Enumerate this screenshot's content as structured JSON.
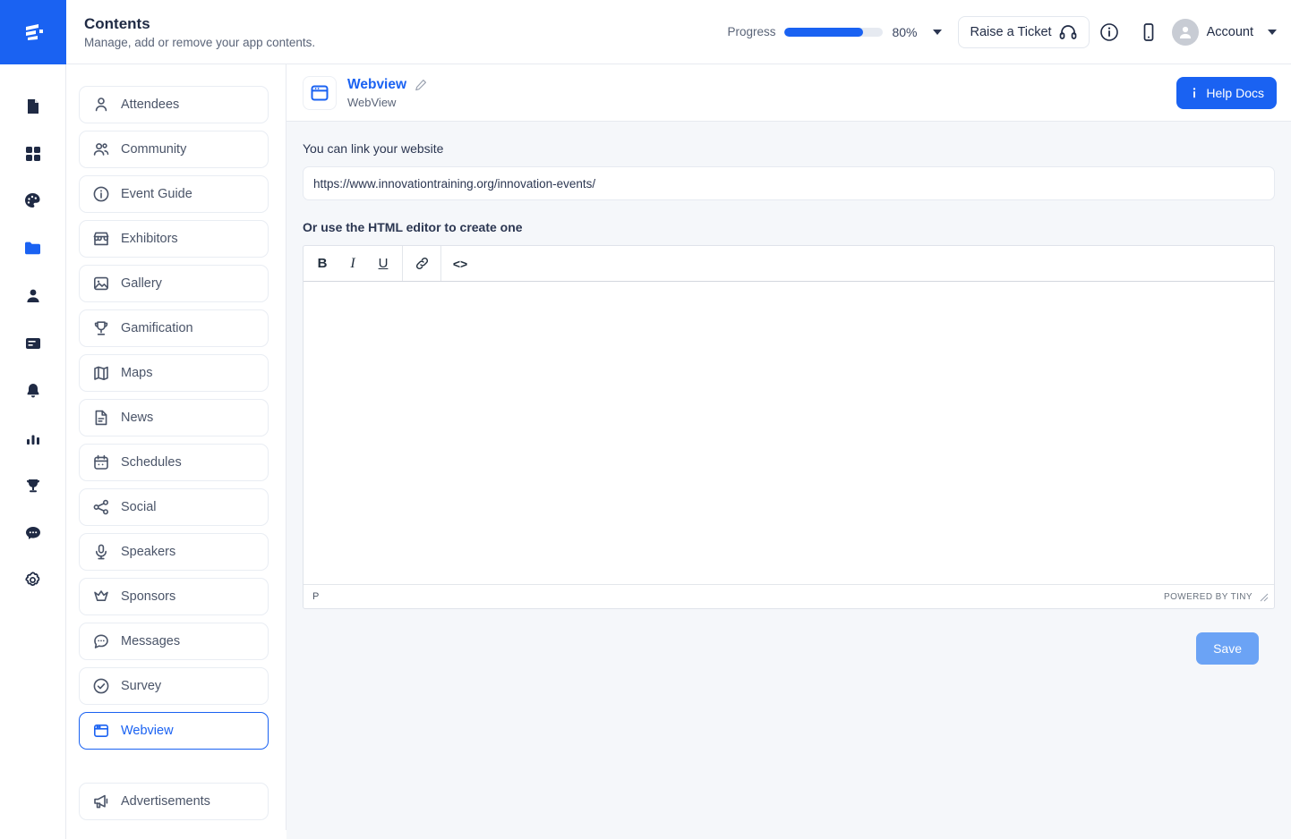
{
  "header": {
    "title": "Contents",
    "subtitle": "Manage, add or remove your app contents.",
    "progress_label": "Progress",
    "progress_percent": "80%",
    "progress_value": 80,
    "ticket_button": "Raise a Ticket",
    "account_label": "Account",
    "logo_icon": "app-logo-icon",
    "info_icon": "info-circle-icon",
    "mobile_icon": "mobile-device-icon",
    "headset_icon": "headset-icon",
    "accent_color": "#1a62f2"
  },
  "rail": {
    "items": [
      {
        "name": "documents",
        "icon": "document-icon",
        "active": false
      },
      {
        "name": "dashboard",
        "icon": "grid-icon",
        "active": false
      },
      {
        "name": "design",
        "icon": "palette-icon",
        "active": false
      },
      {
        "name": "contents",
        "icon": "folder-icon",
        "active": true
      },
      {
        "name": "people",
        "icon": "person-icon",
        "active": false
      },
      {
        "name": "cards",
        "icon": "card-icon",
        "active": false
      },
      {
        "name": "notifications",
        "icon": "bell-icon",
        "active": false
      },
      {
        "name": "analytics",
        "icon": "bar-chart-icon",
        "active": false
      },
      {
        "name": "gamification",
        "icon": "trophy-icon",
        "active": false
      },
      {
        "name": "messages",
        "icon": "chat-icon",
        "active": false
      },
      {
        "name": "settings",
        "icon": "gear-icon",
        "active": false
      }
    ]
  },
  "menu": {
    "items": [
      {
        "label": "Attendees",
        "icon": "person-icon",
        "active": false
      },
      {
        "label": "Community",
        "icon": "people-icon",
        "active": false
      },
      {
        "label": "Event Guide",
        "icon": "info-circle-icon",
        "active": false
      },
      {
        "label": "Exhibitors",
        "icon": "store-icon",
        "active": false
      },
      {
        "label": "Gallery",
        "icon": "image-icon",
        "active": false
      },
      {
        "label": "Gamification",
        "icon": "trophy-icon",
        "active": false
      },
      {
        "label": "Maps",
        "icon": "map-icon",
        "active": false
      },
      {
        "label": "News",
        "icon": "news-icon",
        "active": false
      },
      {
        "label": "Schedules",
        "icon": "calendar-icon",
        "active": false
      },
      {
        "label": "Social",
        "icon": "share-icon",
        "active": false
      },
      {
        "label": "Speakers",
        "icon": "microphone-icon",
        "active": false
      },
      {
        "label": "Sponsors",
        "icon": "crown-icon",
        "active": false
      },
      {
        "label": "Messages",
        "icon": "chat-icon",
        "active": false
      },
      {
        "label": "Survey",
        "icon": "check-circle-icon",
        "active": false
      },
      {
        "label": "Webview",
        "icon": "webview-icon",
        "active": true
      }
    ],
    "footer_items": [
      {
        "label": "Advertisements",
        "icon": "megaphone-icon",
        "active": false
      }
    ]
  },
  "panel": {
    "title": "Webview",
    "subtitle": "WebView",
    "thumb_icon": "webview-icon",
    "edit_icon": "pencil-icon",
    "help_button": "Help Docs",
    "help_icon": "info-icon"
  },
  "form": {
    "url_label": "You can link your website",
    "url_value": "https://www.innovationtraining.org/innovation-events/",
    "url_placeholder": "https://",
    "editor_label": "Or use the HTML editor to create one",
    "save_label": "Save"
  },
  "editor": {
    "toolbar": [
      {
        "name": "bold",
        "glyph": "B"
      },
      {
        "name": "italic",
        "glyph": "I"
      },
      {
        "name": "underline",
        "glyph": "U"
      },
      {
        "name": "link",
        "glyph": "link"
      },
      {
        "name": "code",
        "glyph": "<>"
      }
    ],
    "content": "",
    "status_path": "P",
    "brand": "POWERED BY TINY"
  }
}
